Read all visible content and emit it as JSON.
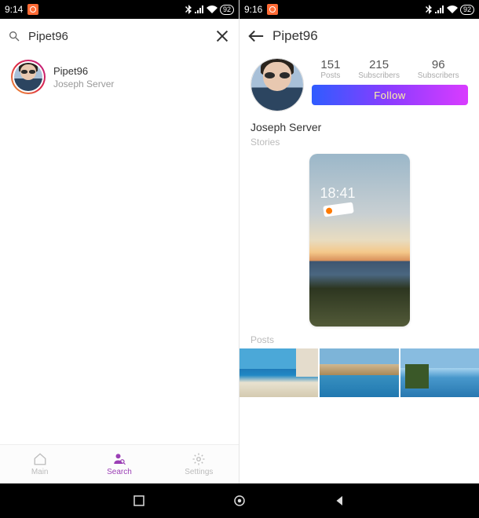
{
  "status": {
    "time_left": "9:14",
    "time_right": "9:16",
    "battery": "92"
  },
  "search": {
    "query": "Pipet96",
    "clear_label": "Clear"
  },
  "result": {
    "username": "Pipet96",
    "fullname": "Joseph Server"
  },
  "nav": {
    "main": "Main",
    "search": "Search",
    "settings": "Settings"
  },
  "profile": {
    "title": "Pipet96",
    "display_name": "Joseph Server",
    "stories_label": "Stories",
    "posts_label": "Posts",
    "follow_label": "Follow",
    "stats": {
      "posts": {
        "num": "151",
        "label": "Posts"
      },
      "subscribers": {
        "num": "215",
        "label": "Subscribers"
      },
      "subscriptions": {
        "num": "96",
        "label": "Subscribers"
      }
    },
    "story_time": "18:41"
  }
}
